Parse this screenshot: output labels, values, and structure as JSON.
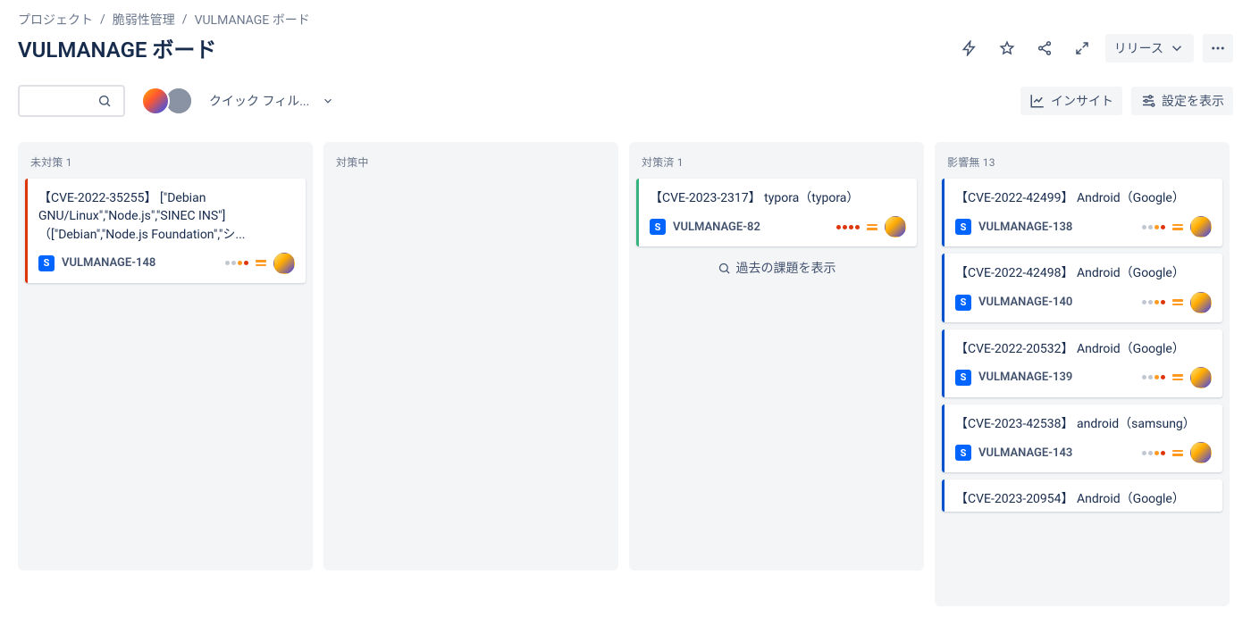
{
  "breadcrumb": {
    "project": "プロジェクト",
    "project2": "脆弱性管理",
    "board": "VULMANAGE ボード"
  },
  "page_title": "VULMANAGE ボード",
  "header_actions": {
    "release": "リリース"
  },
  "toolbar": {
    "quick_filter": "クイック フィル...",
    "insight": "インサイト",
    "settings": "設定を表示",
    "search_placeholder": ""
  },
  "columns": [
    {
      "id": "c1",
      "title": "未対策 1"
    },
    {
      "id": "c2",
      "title": "対策中"
    },
    {
      "id": "c3",
      "title": "対策済 1"
    },
    {
      "id": "c4",
      "title": "影響無 13"
    }
  ],
  "past_issues": "過去の課題を表示",
  "cards": {
    "c1": [
      {
        "title": "【CVE-2022-35255】 [\"Debian GNU/Linux\",\"Node.js\",\"SINEC INS\"]（[\"Debian\",\"Node.js Foundation\",\"シ...",
        "key": "VULMANAGE-148",
        "edge": "red",
        "dots": [
          "grey",
          "grey",
          "orange",
          "red"
        ]
      }
    ],
    "c2": [],
    "c3": [
      {
        "title": "【CVE-2023-2317】 typora（typora）",
        "key": "VULMANAGE-82",
        "edge": "green",
        "dots": [
          "red",
          "red",
          "red",
          "red"
        ]
      }
    ],
    "c4": [
      {
        "title": "【CVE-2022-42499】 Android（Google）",
        "key": "VULMANAGE-138",
        "edge": "blue",
        "dots": [
          "grey",
          "grey",
          "orange",
          "red"
        ]
      },
      {
        "title": "【CVE-2022-42498】 Android（Google）",
        "key": "VULMANAGE-140",
        "edge": "blue",
        "dots": [
          "grey",
          "grey",
          "orange",
          "red"
        ]
      },
      {
        "title": "【CVE-2022-20532】 Android（Google）",
        "key": "VULMANAGE-139",
        "edge": "blue",
        "dots": [
          "grey",
          "grey",
          "orange",
          "red"
        ]
      },
      {
        "title": "【CVE-2023-42538】 android（samsung）",
        "key": "VULMANAGE-143",
        "edge": "blue",
        "dots": [
          "grey",
          "grey",
          "orange",
          "red"
        ]
      },
      {
        "title": "【CVE-2023-20954】 Android（Google）",
        "key": "",
        "edge": "blue",
        "dots": []
      }
    ]
  }
}
